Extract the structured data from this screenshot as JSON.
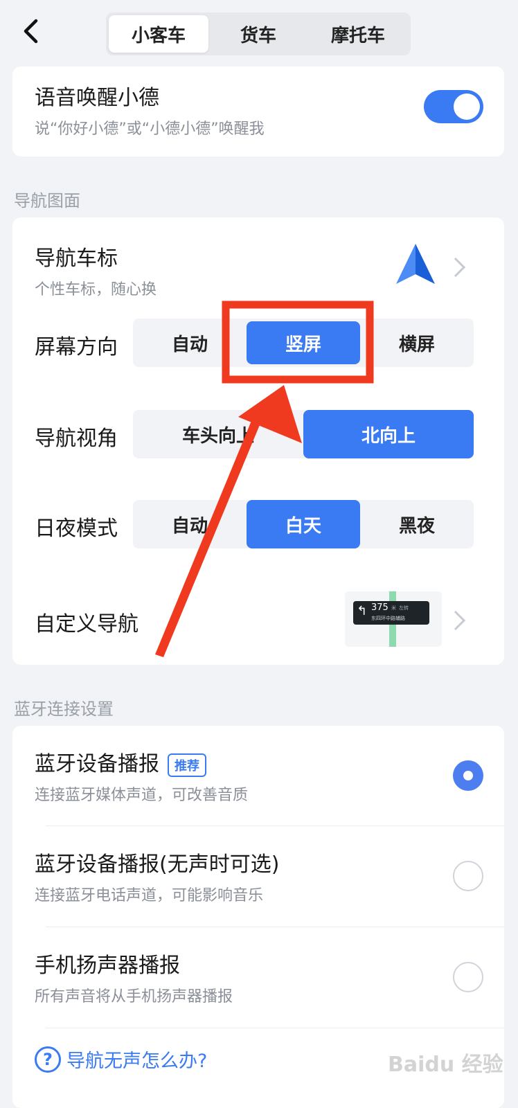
{
  "tabs": [
    "小客车",
    "货车",
    "摩托车"
  ],
  "voice": {
    "title": "语音唤醒小德",
    "subtitle": "说“你好小德”或“小德小德”唤醒我",
    "enabled": true
  },
  "nav_section": {
    "label": "导航图面",
    "car_icon": {
      "title": "导航车标",
      "subtitle": "个性车标，随心换"
    },
    "screen": {
      "label": "屏幕方向",
      "options": [
        "自动",
        "竖屏",
        "横屏"
      ],
      "selected": "竖屏"
    },
    "view": {
      "label": "导航视角",
      "options": [
        "车头向上",
        "北向上"
      ],
      "selected": "北向上"
    },
    "daynight": {
      "label": "日夜模式",
      "options": [
        "自动",
        "白天",
        "黑夜"
      ],
      "selected": "白天"
    },
    "custom": {
      "label": "自定义导航",
      "preview_distance": "375",
      "preview_unit": "米",
      "preview_action": "左转",
      "preview_road": "东四环中路辅路"
    }
  },
  "bt_section": {
    "label": "蓝牙连接设置",
    "options": [
      {
        "title": "蓝牙设备播报",
        "badge": "推荐",
        "subtitle": "连接蓝牙媒体声道，可改善音质",
        "selected": true
      },
      {
        "title": "蓝牙设备播报(无声时可选)",
        "subtitle": "连接蓝牙电话声道，可能影响音乐",
        "selected": false
      },
      {
        "title": "手机扬声器播报",
        "subtitle": "所有声音将从手机扬声器播报",
        "selected": false
      }
    ]
  },
  "help": {
    "label": "导航无声怎么办?",
    "icon": "?"
  },
  "watermark": "Baidu 经验",
  "colors": {
    "accent": "#3a7af2",
    "highlight": "#f03a1f"
  }
}
